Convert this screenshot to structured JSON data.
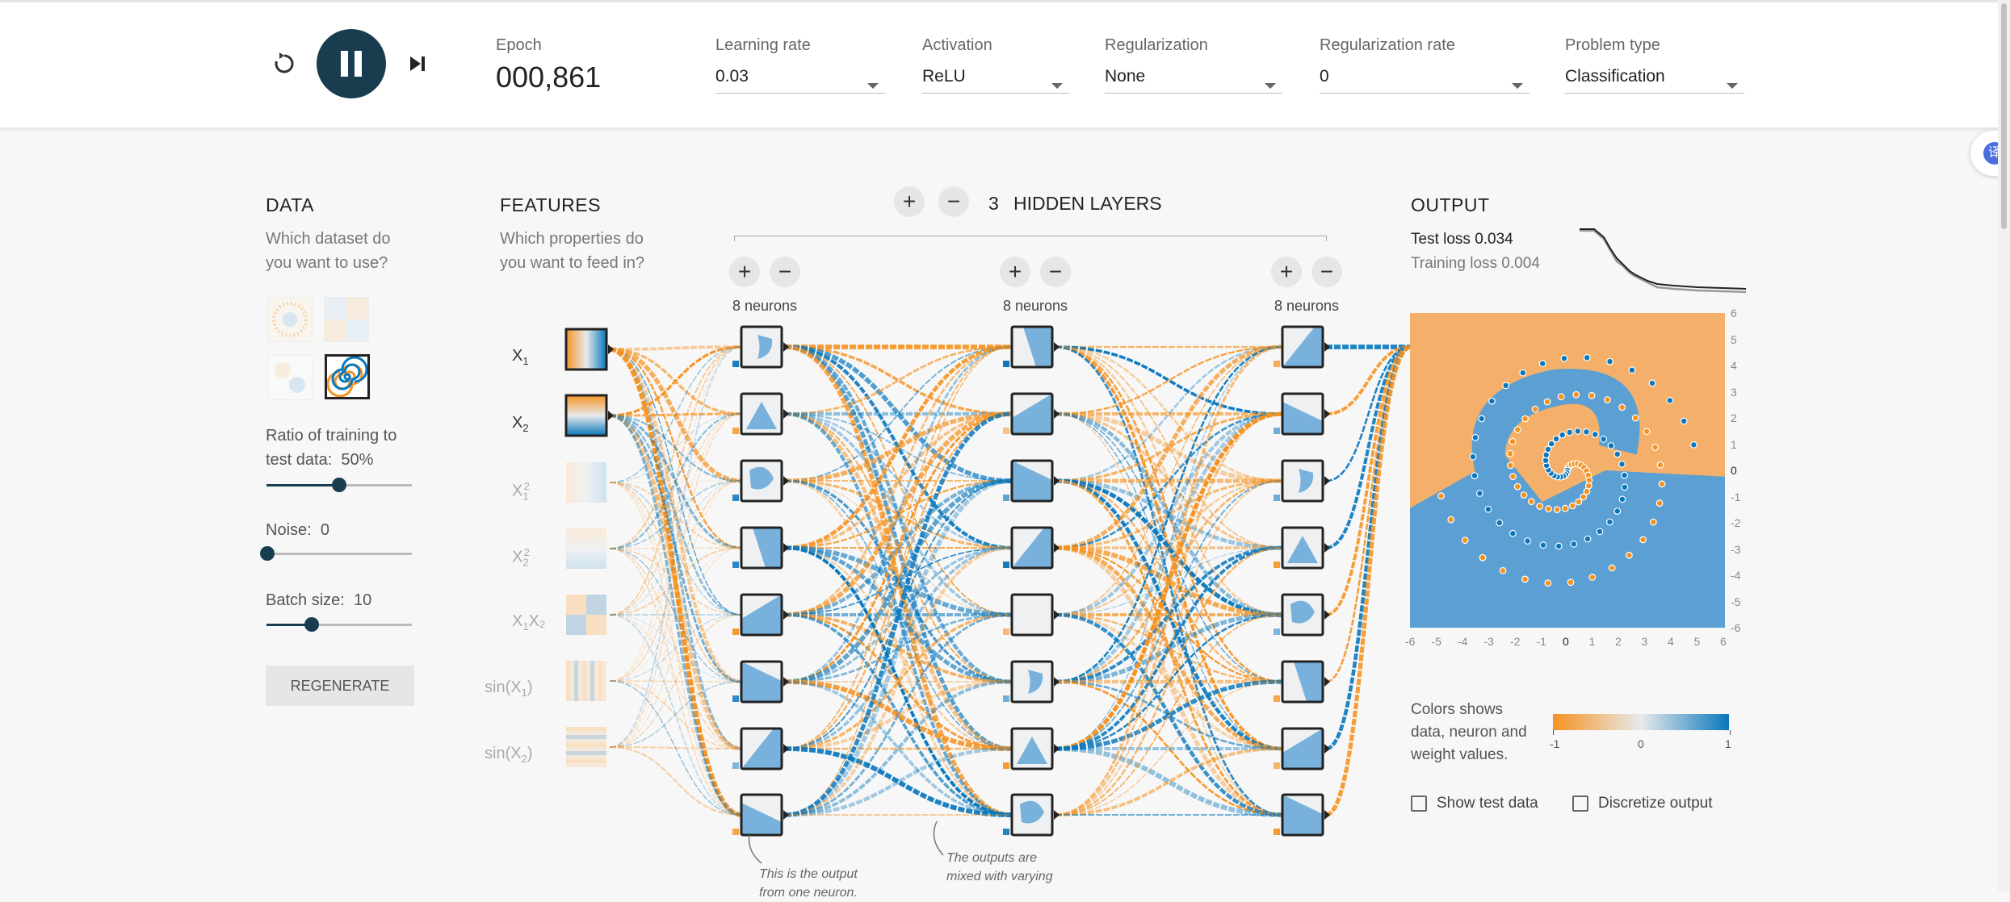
{
  "header": {
    "epoch_label": "Epoch",
    "epoch_value": "000,861",
    "controls": [
      {
        "label": "Learning rate",
        "value": "0.03"
      },
      {
        "label": "Activation",
        "value": "ReLU"
      },
      {
        "label": "Regularization",
        "value": "None"
      },
      {
        "label": "Regularization rate",
        "value": "0"
      },
      {
        "label": "Problem type",
        "value": "Classification"
      }
    ]
  },
  "data_panel": {
    "title": "DATA",
    "question": [
      "Which dataset do",
      "you want to use?"
    ],
    "ratio_label": [
      "Ratio of training to",
      "test data:"
    ],
    "ratio_value": "50%",
    "ratio_fraction": 0.5,
    "noise_label": "Noise:",
    "noise_value": "0",
    "noise_fraction": 0.0,
    "batch_label": "Batch size:",
    "batch_value": "10",
    "batch_fraction": 0.3,
    "regenerate": "REGENERATE"
  },
  "features_panel": {
    "title": "FEATURES",
    "question": [
      "Which properties do",
      "you want to feed in?"
    ],
    "features": [
      {
        "base": "X",
        "sub": "1",
        "sup": "",
        "rest": "",
        "active": true
      },
      {
        "base": "X",
        "sub": "2",
        "sup": "",
        "rest": "",
        "active": true
      },
      {
        "base": "X",
        "sub": "1",
        "sup": "2",
        "rest": "",
        "active": false
      },
      {
        "base": "X",
        "sub": "2",
        "sup": "2",
        "rest": "",
        "active": false
      },
      {
        "base": "X",
        "sub": "1",
        "sup": "",
        "rest": "X₂",
        "active": false
      },
      {
        "base": "sin(X",
        "sub": "1",
        "sup": "",
        "rest": ")",
        "active": false
      },
      {
        "base": "sin(X",
        "sub": "2",
        "sup": "",
        "rest": ")",
        "active": false
      }
    ]
  },
  "network": {
    "hidden_count": "3",
    "hidden_label": "HIDDEN LAYERS",
    "layers": [
      {
        "neurons_label": "8 neurons"
      },
      {
        "neurons_label": "8 neurons"
      },
      {
        "neurons_label": "8 neurons"
      }
    ],
    "annotation1": [
      "This is the output",
      "from one neuron."
    ],
    "annotation2": [
      "The outputs are",
      "mixed with varying"
    ]
  },
  "output_panel": {
    "title": "OUTPUT",
    "test_loss": "Test loss 0.034",
    "training_loss": "Training loss 0.004",
    "axis_ticks": [
      "-6",
      "-5",
      "-4",
      "-3",
      "-2",
      "-1",
      "0",
      "1",
      "2",
      "3",
      "4",
      "5",
      "6"
    ],
    "y_axis_ticks": [
      "6",
      "5",
      "4",
      "3",
      "2",
      "1",
      "0",
      "-1",
      "-2",
      "-3",
      "-4",
      "-5",
      "-6"
    ],
    "legend_text": [
      "Colors shows",
      "data, neuron and",
      "weight values."
    ],
    "legend_ticks": [
      "-1",
      "0",
      "1"
    ],
    "show_test_data": "Show test data",
    "discretize_output": "Discretize output"
  },
  "colors": {
    "orange": "#f59322",
    "blue": "#0877bd",
    "dark": "#183D4E"
  }
}
